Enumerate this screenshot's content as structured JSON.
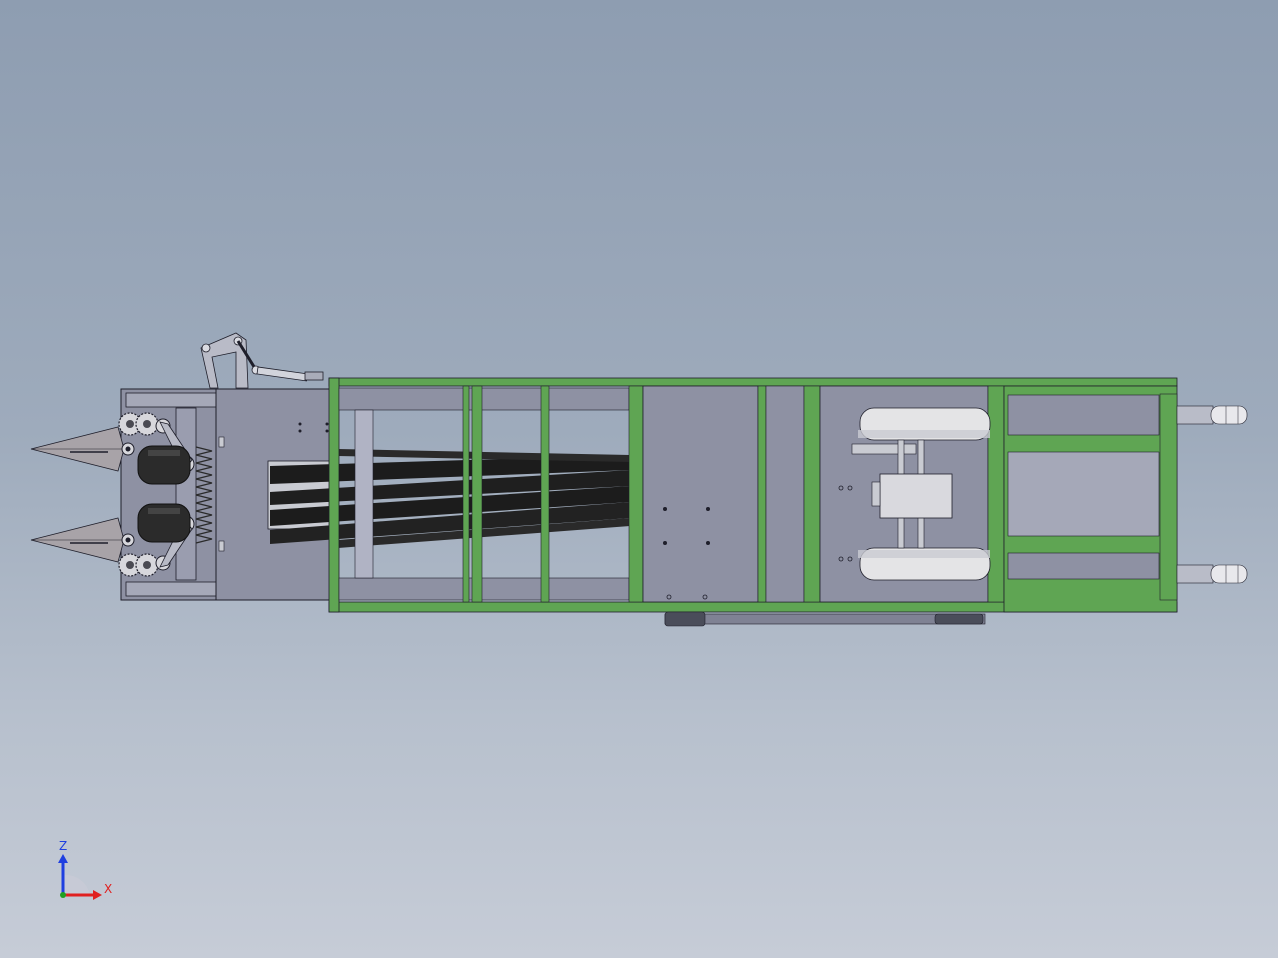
{
  "app": {
    "view": "cad-3d-viewport",
    "background_top": "#8e9db1",
    "background_bottom": "#c6ccd7"
  },
  "colors": {
    "frame_green": "#5fa553",
    "frame_green_dark": "#3f7d37",
    "panel_gray": "#8e91a3",
    "panel_gray_light": "#a5a8b8",
    "belt_black": "#1c1c1c",
    "roller_black": "#2b2b2b",
    "wheel_light": "#e4e4e6",
    "steel": "#c9cbd2",
    "outline": "#1e1e2a"
  },
  "triad": {
    "z_label": "Z",
    "x_label": "X",
    "z_color": "#1f3fe0",
    "x_color": "#e02020",
    "y_color": "#20a020",
    "icon": "coordinate-triad-icon"
  }
}
